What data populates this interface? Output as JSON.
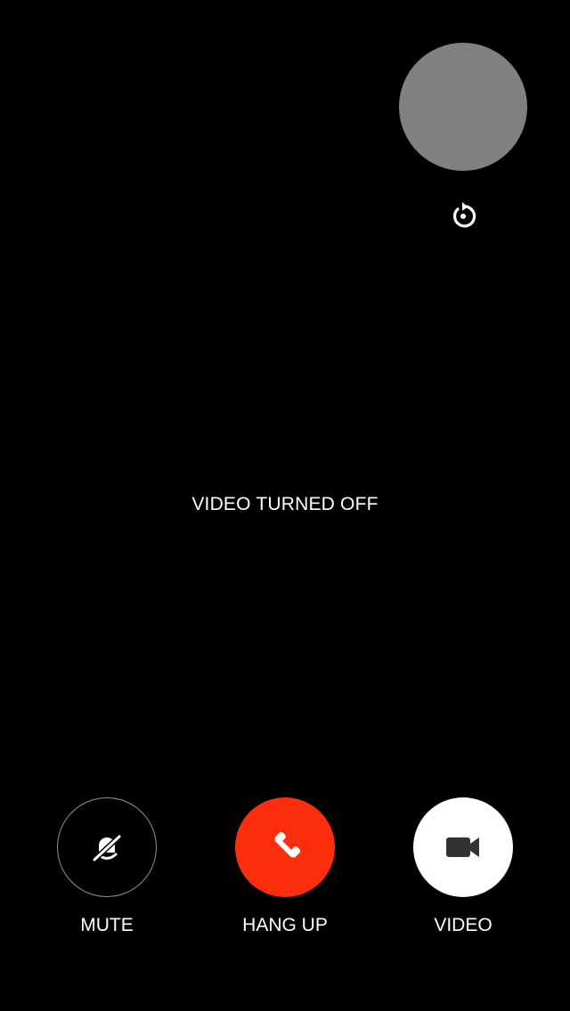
{
  "call": {
    "status_text": "VIDEO TURNED OFF"
  },
  "self_view": {
    "color": "#808080"
  },
  "controls": {
    "flip_icon": "camera-flip-icon",
    "mute": {
      "label": "MUTE",
      "icon": "mic-off-icon"
    },
    "hangup": {
      "label": "HANG UP",
      "icon": "phone-hangup-icon",
      "color": "#fe2d0c"
    },
    "video": {
      "label": "VIDEO",
      "icon": "video-camera-icon"
    }
  }
}
